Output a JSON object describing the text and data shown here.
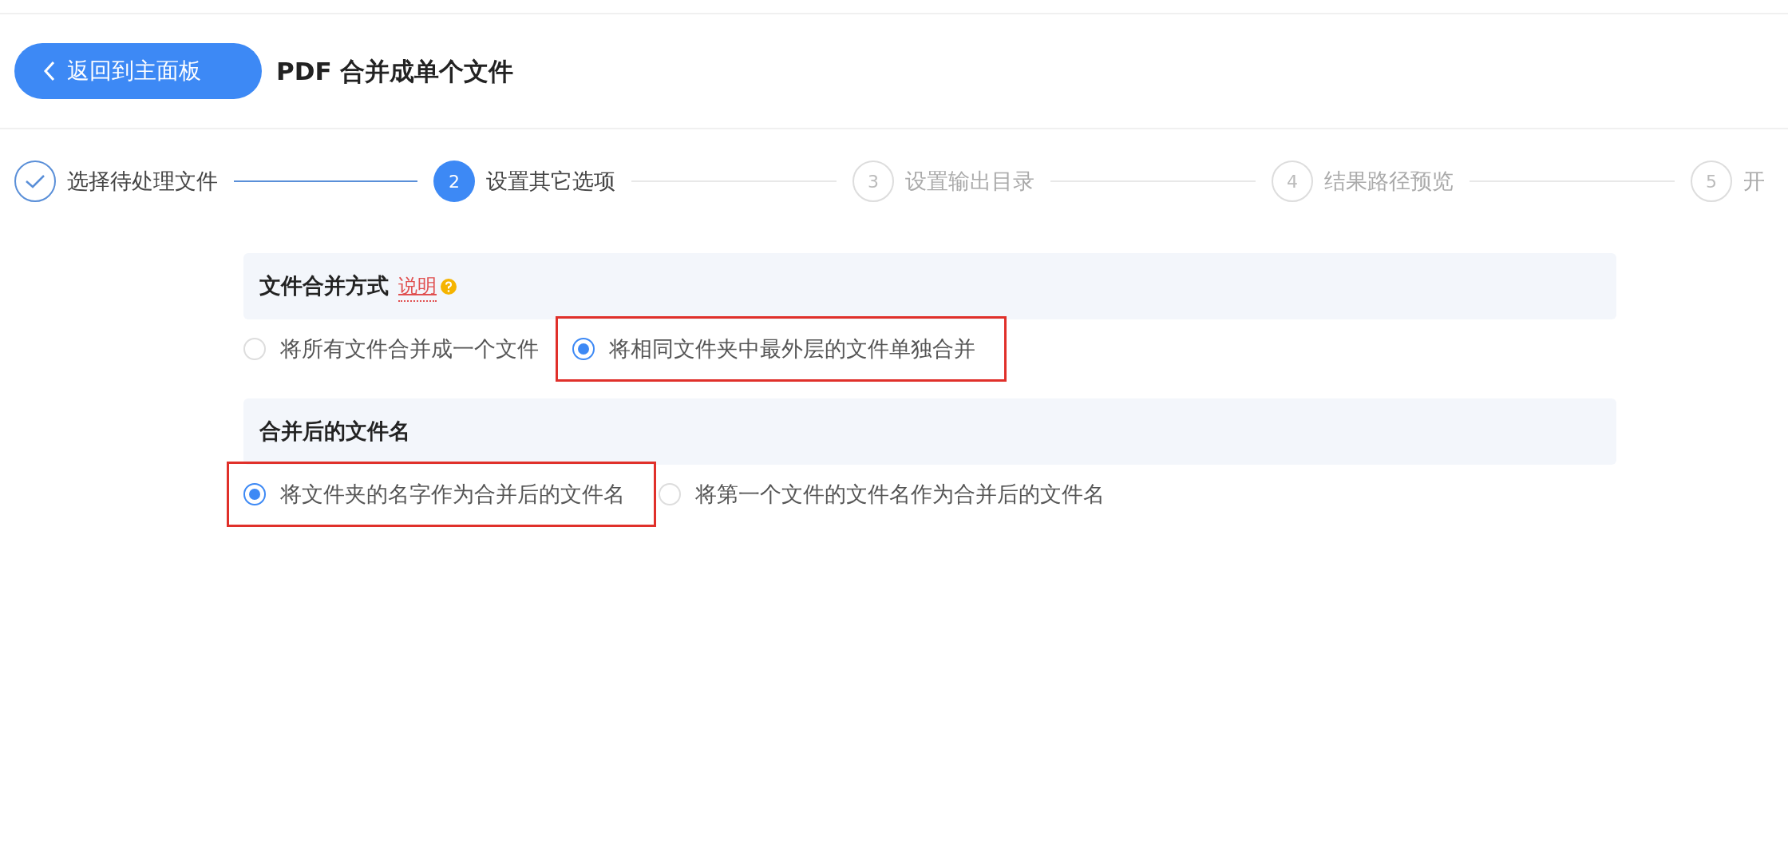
{
  "header": {
    "back_button": "返回到主面板",
    "title": "PDF 合并成单个文件"
  },
  "steps": [
    {
      "label": "选择待处理文件",
      "completed": true,
      "current": false
    },
    {
      "marker": "2",
      "label": "设置其它选项",
      "completed": false,
      "current": true
    },
    {
      "marker": "3",
      "label": "设置输出目录",
      "completed": false,
      "current": false
    },
    {
      "marker": "4",
      "label": "结果路径预览",
      "completed": false,
      "current": false
    },
    {
      "marker": "5",
      "label": "开",
      "completed": false,
      "current": false
    }
  ],
  "groups": [
    {
      "title": "文件合并方式",
      "help_link": "说明",
      "options": [
        {
          "label": "将所有文件合并成一个文件",
          "selected": false,
          "highlighted": false
        },
        {
          "label": "将相同文件夹中最外层的文件单独合并",
          "selected": true,
          "highlighted": true
        }
      ]
    },
    {
      "title": "合并后的文件名",
      "options": [
        {
          "label": "将文件夹的名字作为合并后的文件名",
          "selected": true,
          "highlighted": true
        },
        {
          "label": "将第一个文件的文件名作为合并后的文件名",
          "selected": false,
          "highlighted": false
        }
      ]
    }
  ]
}
